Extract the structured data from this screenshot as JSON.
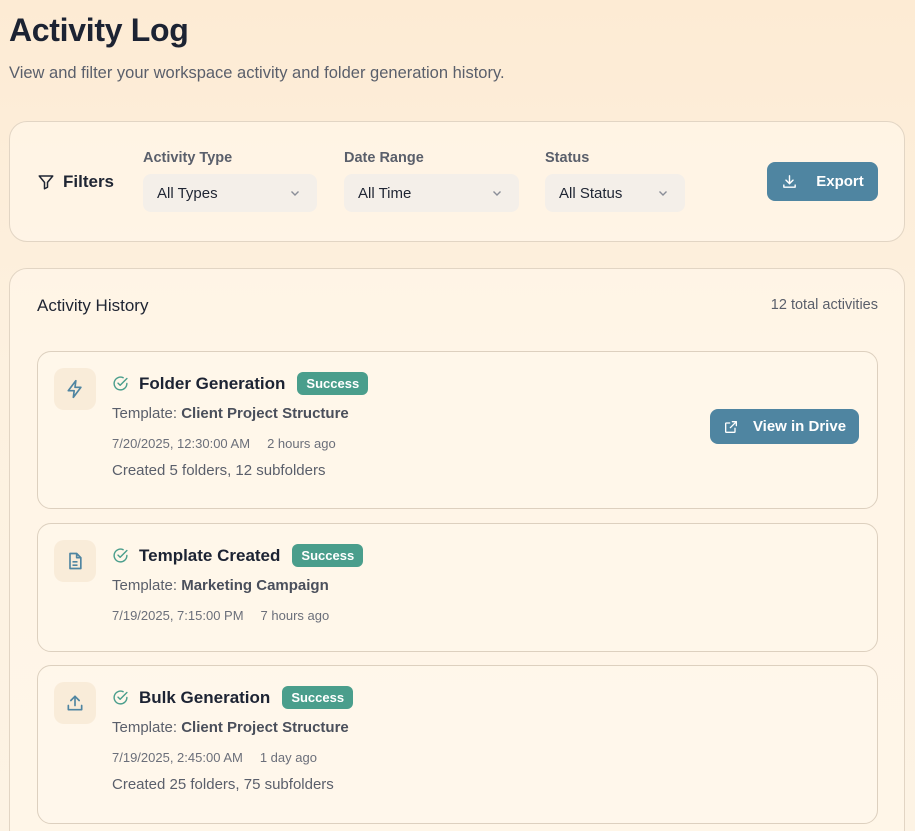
{
  "header": {
    "title": "Activity Log",
    "subtitle": "View and filter your workspace activity and folder generation history."
  },
  "filters": {
    "label": "Filters",
    "activity_type": {
      "label": "Activity Type",
      "value": "All Types"
    },
    "date_range": {
      "label": "Date Range",
      "value": "All Time"
    },
    "status": {
      "label": "Status",
      "value": "All Status"
    },
    "export_label": "Export"
  },
  "history": {
    "title": "Activity History",
    "count": "12 total activities",
    "items": [
      {
        "icon": "lightning-icon",
        "name": "Folder Generation",
        "status": "Success",
        "template_prefix": "Template:",
        "template": "Client Project Structure",
        "datetime": "7/20/2025, 12:30:00 AM",
        "relative": "2 hours ago",
        "detail": "Created 5 folders, 12 subfolders",
        "action": "View in Drive"
      },
      {
        "icon": "document-icon",
        "name": "Template Created",
        "status": "Success",
        "template_prefix": "Template:",
        "template": "Marketing Campaign",
        "datetime": "7/19/2025, 7:15:00 PM",
        "relative": "7 hours ago"
      },
      {
        "icon": "upload-icon",
        "name": "Bulk Generation",
        "status": "Success",
        "template_prefix": "Template:",
        "template": "Client Project Structure",
        "datetime": "7/19/2025, 2:45:00 AM",
        "relative": "1 day ago",
        "detail": "Created 25 folders, 75 subfolders"
      }
    ]
  },
  "colors": {
    "accent": "#4f85a1",
    "success": "#4a9e8c",
    "check": "#4a9e8c"
  }
}
